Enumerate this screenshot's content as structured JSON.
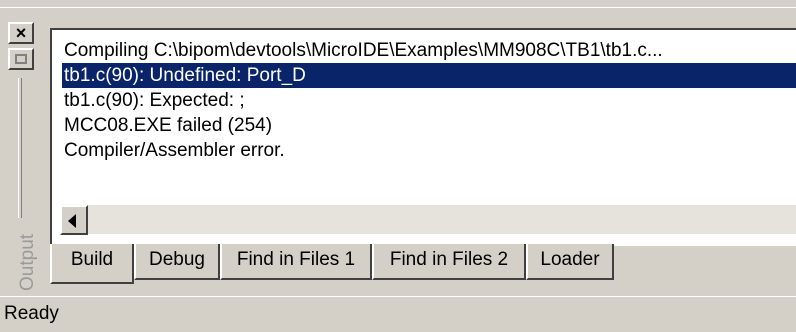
{
  "window": {
    "close_label": "×",
    "panel_title": "Output"
  },
  "output": {
    "lines": [
      "Compiling C:\\bipom\\devtools\\MicroIDE\\Examples\\MM908C\\TB1\\tb1.c...",
      "tb1.c(90): Undefined: Port_D",
      "tb1.c(90): Expected: ;",
      "MCC08.EXE failed (254)",
      "Compiler/Assembler error."
    ],
    "selected_index": 1
  },
  "tabs": [
    {
      "label": "Build"
    },
    {
      "label": "Debug"
    },
    {
      "label": "Find in Files 1"
    },
    {
      "label": "Find in Files 2"
    },
    {
      "label": "Loader"
    }
  ],
  "status": {
    "text": "Ready"
  },
  "icons": {
    "close": "close-icon",
    "restore": "restore-icon",
    "scroll_left": "arrow-left-icon"
  }
}
